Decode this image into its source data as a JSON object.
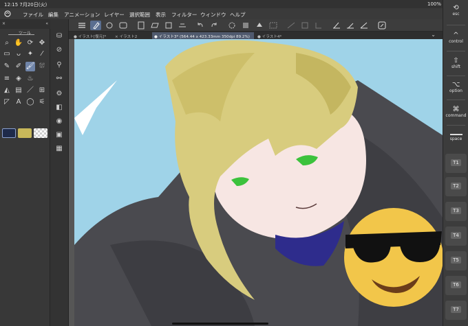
{
  "status_bar": {
    "time_date": "12:15  7月20日(火)",
    "battery": "100%"
  },
  "menu": {
    "items": [
      "ファイル",
      "編集",
      "アニメーション",
      "レイヤー",
      "選択範囲",
      "表示",
      "フィルター",
      "ウィンドウ",
      "ヘルプ"
    ]
  },
  "left_panel": {
    "title": "ツール",
    "close_symbol": "×",
    "collapse_symbol": "«"
  },
  "tabs": [
    {
      "label": "● イラスト[復元]*",
      "active": false
    },
    {
      "label": "× イラスト2",
      "active": false
    },
    {
      "label": "● イラスト3* (564.44 x 423.33mm 350dpi 89.2%)",
      "active": true
    },
    {
      "label": "● イラスト4*",
      "active": false
    }
  ],
  "tab_chevron": "⌄",
  "keys": {
    "esc": "esc",
    "control": "control",
    "shift": "shift",
    "option": "option",
    "command": "command",
    "space": "space",
    "t1": "T1",
    "t2": "T2",
    "t3": "T3",
    "t4": "T4",
    "t5": "T5",
    "t6": "T6",
    "t7": "T7"
  },
  "colors": {
    "main_color": "#1e2a4a",
    "sub_color": "#c8b85a",
    "canvas_bg": "#9fd3e8",
    "hair": "#d8cc7e",
    "jacket": "#4a4a4f",
    "emoji": "#f2c64a",
    "active_tool": "#6f84a8"
  }
}
